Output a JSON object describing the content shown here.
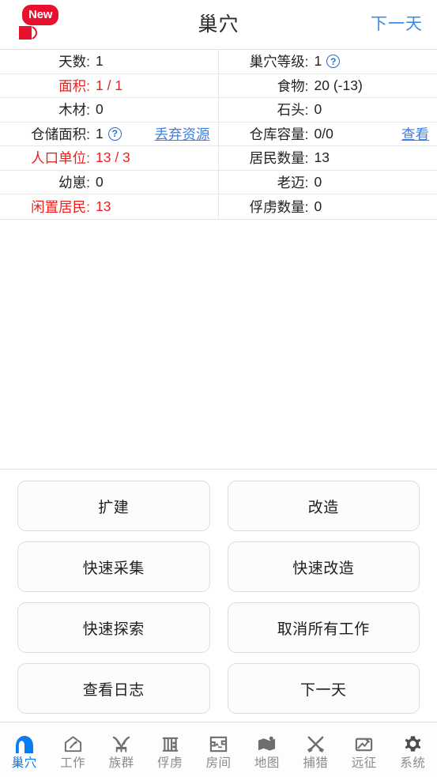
{
  "header": {
    "badge_label": "New",
    "badge_icon": "megaphone-icon",
    "title": "巢穴",
    "action_label": "下一天",
    "action_color": "#3c8ce4"
  },
  "stats": {
    "rows": [
      {
        "left": {
          "label": "天数:",
          "value": "1",
          "color": "normal",
          "help": false,
          "link": ""
        },
        "right": {
          "label": "巢穴等级:",
          "value": "1",
          "color": "normal",
          "help": true,
          "link": ""
        }
      },
      {
        "left": {
          "label": "面积:",
          "value": "1 / 1",
          "color": "red",
          "help": false,
          "link": ""
        },
        "right": {
          "label": "食物:",
          "value": "20 (-13)",
          "color": "normal",
          "help": false,
          "link": ""
        }
      },
      {
        "left": {
          "label": "木材:",
          "value": "0",
          "color": "normal",
          "help": false,
          "link": ""
        },
        "right": {
          "label": "石头:",
          "value": "0",
          "color": "normal",
          "help": false,
          "link": ""
        }
      },
      {
        "left": {
          "label": "仓储面积:",
          "value": "1",
          "color": "normal",
          "help": true,
          "link": "丢弃资源"
        },
        "right": {
          "label": "仓库容量:",
          "value": "0/0",
          "color": "normal",
          "help": false,
          "link": "查看"
        }
      },
      {
        "left": {
          "label": "人口单位:",
          "value": "13 / 3",
          "color": "red",
          "help": false,
          "link": ""
        },
        "right": {
          "label": "居民数量:",
          "value": "13",
          "color": "normal",
          "help": false,
          "link": ""
        }
      },
      {
        "left": {
          "label": "幼崽:",
          "value": "0",
          "color": "normal",
          "help": false,
          "link": ""
        },
        "right": {
          "label": "老迈:",
          "value": "0",
          "color": "normal",
          "help": false,
          "link": ""
        }
      },
      {
        "left": {
          "label": "闲置居民:",
          "value": "13",
          "color": "red",
          "help": false,
          "link": ""
        },
        "right": {
          "label": "俘虏数量:",
          "value": "0",
          "color": "normal",
          "help": false,
          "link": ""
        }
      }
    ],
    "help_glyph": "?",
    "red_color": "#e8231f",
    "link_color": "#3c7fe0"
  },
  "actions": [
    {
      "label": "扩建",
      "name": "expand-button"
    },
    {
      "label": "改造",
      "name": "rebuild-button"
    },
    {
      "label": "快速采集",
      "name": "quick-gather-button"
    },
    {
      "label": "快速改造",
      "name": "quick-rebuild-button"
    },
    {
      "label": "快速探索",
      "name": "quick-explore-button"
    },
    {
      "label": "取消所有工作",
      "name": "cancel-all-jobs-button"
    },
    {
      "label": "查看日志",
      "name": "view-log-button"
    },
    {
      "label": "下一天",
      "name": "next-day-button"
    }
  ],
  "tabbar": {
    "active_color": "#0b7bf0",
    "inactive_color": "#8a8a8a",
    "items": [
      {
        "label": "巢穴",
        "icon": "nest-icon",
        "active": true
      },
      {
        "label": "工作",
        "icon": "work-icon",
        "active": false
      },
      {
        "label": "族群",
        "icon": "clan-icon",
        "active": false
      },
      {
        "label": "俘虏",
        "icon": "prison-icon",
        "active": false
      },
      {
        "label": "房间",
        "icon": "room-icon",
        "active": false
      },
      {
        "label": "地图",
        "icon": "map-icon",
        "active": false
      },
      {
        "label": "捕猎",
        "icon": "hunt-icon",
        "active": false
      },
      {
        "label": "远征",
        "icon": "expedition-icon",
        "active": false
      },
      {
        "label": "系统",
        "icon": "gear-icon",
        "active": false
      }
    ]
  }
}
